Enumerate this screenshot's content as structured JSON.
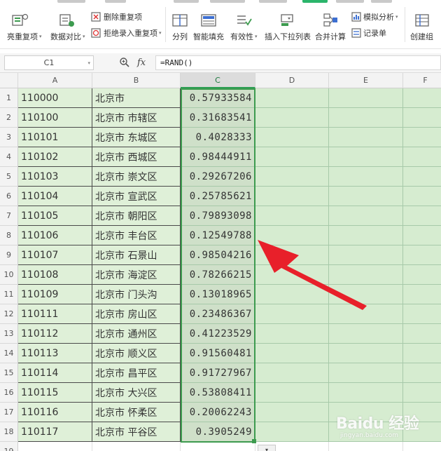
{
  "ribbon": {
    "buttons": [
      {
        "label": "亮重复项",
        "icon": "highlight-duplicates-icon",
        "has_dropdown": true
      },
      {
        "label": "数据对比",
        "icon": "data-compare-icon",
        "has_dropdown": true
      },
      {
        "label": "删除重复项",
        "icon": "delete-duplicates-icon",
        "has_dropdown": false
      },
      {
        "label": "拒绝录入重复项",
        "icon": "reject-duplicates-icon",
        "has_dropdown": true
      },
      {
        "label": "分列",
        "icon": "split-column-icon",
        "has_dropdown": false
      },
      {
        "label": "智能填充",
        "icon": "smart-fill-icon",
        "has_dropdown": false
      },
      {
        "label": "有效性",
        "icon": "validity-icon",
        "has_dropdown": true
      },
      {
        "label": "插入下拉列表",
        "icon": "insert-dropdown-list-icon",
        "has_dropdown": false
      },
      {
        "label": "合并计算",
        "icon": "consolidate-icon",
        "has_dropdown": false
      },
      {
        "label": "模拟分析",
        "icon": "what-if-analysis-icon",
        "has_dropdown": true
      },
      {
        "label": "记录单",
        "icon": "record-form-icon",
        "has_dropdown": false
      },
      {
        "label": "创建组",
        "icon": "create-group-icon",
        "has_dropdown": false
      }
    ]
  },
  "formula_bar": {
    "name_box": "C1",
    "formula": "=RAND()"
  },
  "columns": [
    "A",
    "B",
    "C",
    "D",
    "E",
    "F"
  ],
  "selected_column": "C",
  "rows": [
    {
      "num": "1",
      "a": "110000",
      "b": "北京市",
      "c": "0.57933584"
    },
    {
      "num": "2",
      "a": "110100",
      "b": "北京市 市辖区",
      "c": "0.31683541"
    },
    {
      "num": "3",
      "a": "110101",
      "b": "北京市 东城区",
      "c": "0.4028333"
    },
    {
      "num": "4",
      "a": "110102",
      "b": "北京市 西城区",
      "c": "0.98444911"
    },
    {
      "num": "5",
      "a": "110103",
      "b": "北京市 崇文区",
      "c": "0.29267206"
    },
    {
      "num": "6",
      "a": "110104",
      "b": "北京市 宣武区",
      "c": "0.25785621"
    },
    {
      "num": "7",
      "a": "110105",
      "b": "北京市 朝阳区",
      "c": "0.79893098"
    },
    {
      "num": "8",
      "a": "110106",
      "b": "北京市 丰台区",
      "c": "0.12549788"
    },
    {
      "num": "9",
      "a": "110107",
      "b": "北京市 石景山",
      "c": "0.98504216"
    },
    {
      "num": "10",
      "a": "110108",
      "b": "北京市 海淀区",
      "c": "0.78266215"
    },
    {
      "num": "11",
      "a": "110109",
      "b": "北京市 门头沟",
      "c": "0.13018965"
    },
    {
      "num": "12",
      "a": "110111",
      "b": "北京市 房山区",
      "c": "0.23486367"
    },
    {
      "num": "13",
      "a": "110112",
      "b": "北京市 通州区",
      "c": "0.41223529"
    },
    {
      "num": "14",
      "a": "110113",
      "b": "北京市 顺义区",
      "c": "0.91560481"
    },
    {
      "num": "15",
      "a": "110114",
      "b": "北京市 昌平区",
      "c": "0.91727967"
    },
    {
      "num": "16",
      "a": "110115",
      "b": "北京市 大兴区",
      "c": "0.53808411"
    },
    {
      "num": "17",
      "a": "110116",
      "b": "北京市 怀柔区",
      "c": "0.20062243"
    },
    {
      "num": "18",
      "a": "110117",
      "b": "北京市 平谷区",
      "c": "0.3905249"
    },
    {
      "num": "19",
      "a": "",
      "b": "",
      "c": ""
    }
  ],
  "annotation": {
    "icon": "red-arrow-icon",
    "color": "#e8202a"
  },
  "watermark": {
    "logo": "Baidu 经验",
    "url": "jingyan.baidu.com"
  },
  "colors": {
    "selection": "#3d9b4f",
    "cell_fill": "#dff0d8",
    "arrow": "#e8202a"
  }
}
